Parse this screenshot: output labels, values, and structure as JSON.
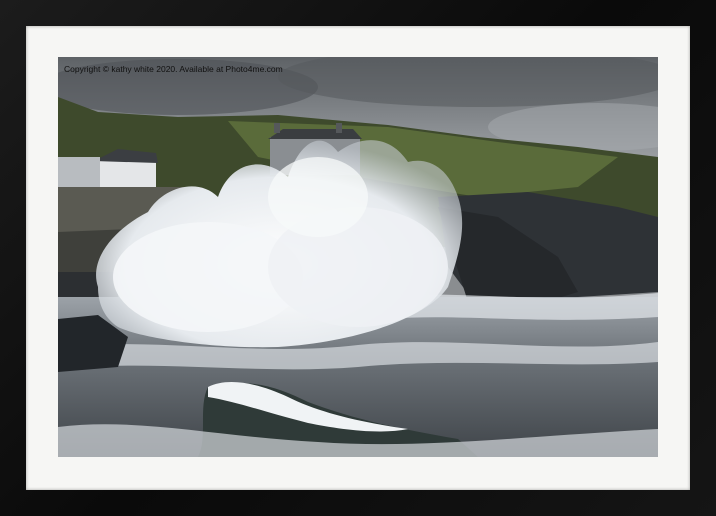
{
  "image": {
    "copyright_text": "Copyright © kathy white 2020. Available at Photo4me.com"
  },
  "colors": {
    "frame": "#111111",
    "mount": "#f6f6f4",
    "sky": "#9ea2a6",
    "hill_green": "#4d5c34",
    "sea": "#5c6268",
    "spray": "#f4f6f8"
  }
}
